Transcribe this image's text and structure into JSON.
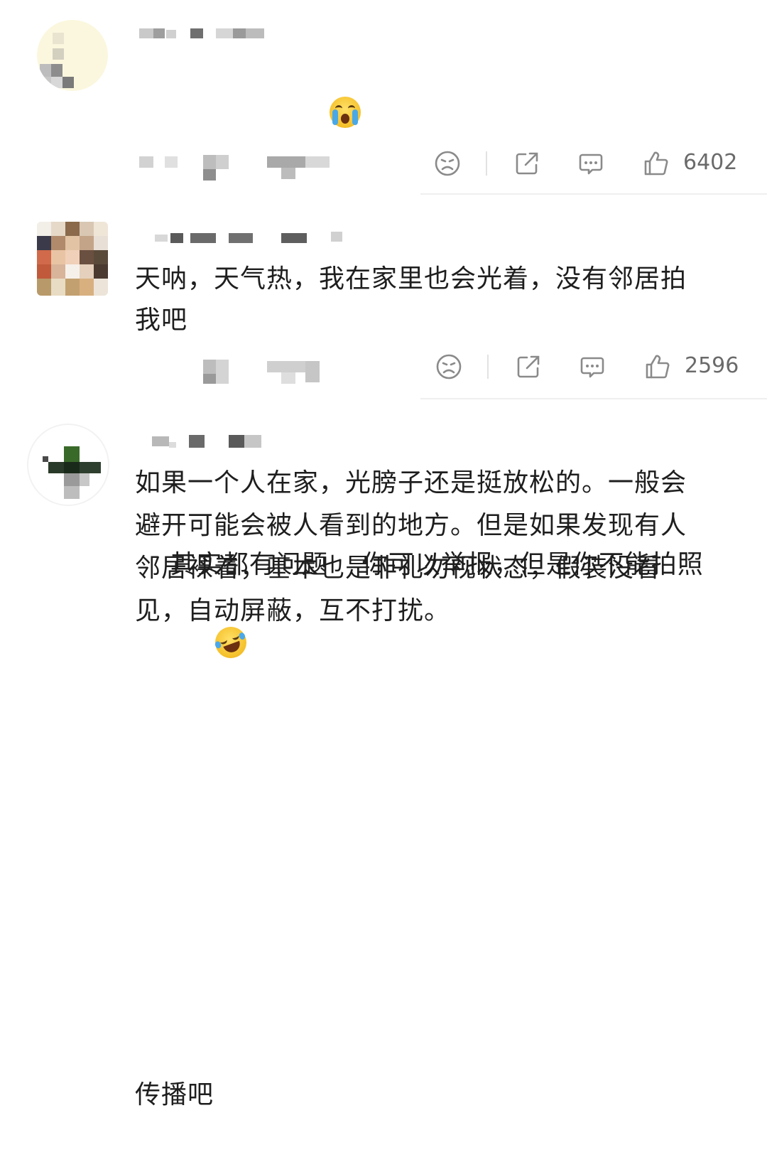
{
  "comments": [
    {
      "text_line1": "其实都有问题",
      "emoji1": "crying-face-emoji",
      "text_line1b": "你可以举报，但是你不能拍照",
      "text_line2": "传播吧",
      "emoji2": "laughing-crying-face-emoji",
      "likes": "6402"
    },
    {
      "text": "天呐，天气热，我在家里也会光着，没有邻居拍\n我吧",
      "likes": "2596"
    },
    {
      "text": "如果一个人在家，光膀子还是挺放松的。一般会\n避开可能会被人看到的地方。但是如果发现有人\n邻居裸着，基本也是非礼勿视状态，假装没看\n见，自动屏蔽，互不打扰。"
    }
  ],
  "icons": {
    "dislike": "sad-face-icon",
    "share": "share-icon",
    "reply": "comment-icon",
    "like": "thumbs-up-icon"
  },
  "colors": {
    "icon_gray": "#8a8a8a",
    "divider": "#efefef",
    "text": "#1e1e1e"
  }
}
